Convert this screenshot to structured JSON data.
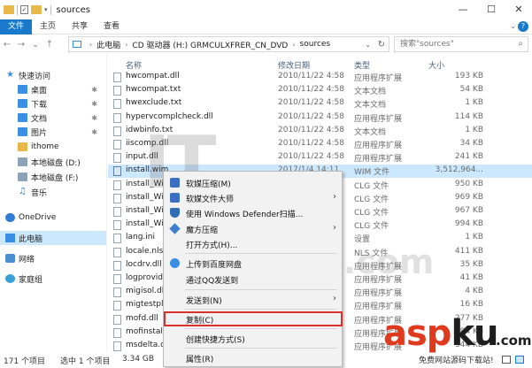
{
  "window": {
    "title": "sources",
    "minimize": "—",
    "maximize": "☐",
    "close": "✕"
  },
  "ribbon": {
    "tabs": [
      "文件",
      "主页",
      "共享",
      "查看"
    ],
    "help": "?"
  },
  "address": {
    "crumbs": [
      "此电脑",
      "CD 驱动器 (H:) GRMCULXFRER_CN_DVD",
      "sources"
    ],
    "search_placeholder": "搜索\"sources\""
  },
  "sidebar": {
    "items": [
      {
        "label": "快速访问",
        "icon": "star-icon"
      },
      {
        "label": "桌面",
        "icon": "desktop-folder-icon"
      },
      {
        "label": "下载",
        "icon": "download-folder-icon"
      },
      {
        "label": "文档",
        "icon": "documents-folder-icon"
      },
      {
        "label": "图片",
        "icon": "pictures-folder-icon"
      },
      {
        "label": "ithome",
        "icon": "folder-icon"
      },
      {
        "label": "本地磁盘 (D:)",
        "icon": "drive-icon"
      },
      {
        "label": "本地磁盘 (F:)",
        "icon": "drive-icon"
      },
      {
        "label": "音乐",
        "icon": "music-icon"
      },
      {
        "label": "OneDrive",
        "icon": "cloud-icon"
      },
      {
        "label": "此电脑",
        "icon": "computer-icon"
      },
      {
        "label": "网络",
        "icon": "network-icon"
      },
      {
        "label": "家庭组",
        "icon": "homegroup-icon"
      }
    ]
  },
  "columns": {
    "name": "名称",
    "date": "修改日期",
    "type": "类型",
    "size": "大小"
  },
  "files": [
    {
      "name": "hwcompat.dll",
      "date": "2010/11/22 4:58",
      "type": "应用程序扩展",
      "size": "193 KB"
    },
    {
      "name": "hwcompat.txt",
      "date": "2010/11/22 4:58",
      "type": "文本文档",
      "size": "54 KB"
    },
    {
      "name": "hwexclude.txt",
      "date": "2010/11/22 4:58",
      "type": "文本文档",
      "size": "1 KB"
    },
    {
      "name": "hypervcomplcheck.dll",
      "date": "2010/11/22 4:58",
      "type": "应用程序扩展",
      "size": "114 KB"
    },
    {
      "name": "idwbinfo.txt",
      "date": "2010/11/22 4:58",
      "type": "文本文档",
      "size": "1 KB"
    },
    {
      "name": "iiscomp.dll",
      "date": "2010/11/22 4:58",
      "type": "应用程序扩展",
      "size": "34 KB"
    },
    {
      "name": "input.dll",
      "date": "2010/11/22 4:58",
      "type": "应用程序扩展",
      "size": "241 KB"
    },
    {
      "name": "install.wim",
      "date": "2017/1/4 14:11",
      "type": "WIM 文件",
      "size": "3,512,964..."
    },
    {
      "name": "install_Wi",
      "date": "",
      "type": "CLG 文件",
      "size": "950 KB"
    },
    {
      "name": "install_Wi",
      "date": "",
      "type": "CLG 文件",
      "size": "969 KB"
    },
    {
      "name": "install_Wi",
      "date": "",
      "type": "CLG 文件",
      "size": "967 KB"
    },
    {
      "name": "install_Wi",
      "date": "",
      "type": "CLG 文件",
      "size": "994 KB"
    },
    {
      "name": "lang.ini",
      "date": "",
      "type": "设置",
      "size": "1 KB"
    },
    {
      "name": "locale.nls",
      "date": "",
      "type": "NLS 文件",
      "size": "411 KB"
    },
    {
      "name": "locdrv.dll",
      "date": "",
      "type": "应用程序扩展",
      "size": "35 KB"
    },
    {
      "name": "logprovide",
      "date": "",
      "type": "应用程序扩展",
      "size": "41 KB"
    },
    {
      "name": "migisol.dll",
      "date": "",
      "type": "应用程序扩展",
      "size": "4 KB"
    },
    {
      "name": "migtestplu",
      "date": "",
      "type": "应用程序扩展",
      "size": "16 KB"
    },
    {
      "name": "mofd.dll",
      "date": "",
      "type": "应用程序扩展",
      "size": "277 KB"
    },
    {
      "name": "mofinstall.",
      "date": "",
      "type": "应用程序扩展",
      "size": "84 KB"
    },
    {
      "name": "msdelta.dl",
      "date": "",
      "type": "应用程序扩展",
      "size": "344 KB"
    }
  ],
  "context_menu": {
    "items": [
      {
        "label": "软媒压缩(M)",
        "icon": "zip-icon",
        "submenu": false
      },
      {
        "label": "软媒文件大师",
        "icon": "zip-icon",
        "submenu": true
      },
      {
        "label": "使用 Windows Defender扫描...",
        "icon": "shield-icon",
        "submenu": false
      },
      {
        "label": "魔方压缩",
        "icon": "cube-icon",
        "submenu": true
      },
      {
        "label": "打开方式(H)...",
        "icon": "",
        "submenu": false
      },
      {
        "label": "上传到百度网盘",
        "icon": "upload-icon",
        "submenu": false
      },
      {
        "label": "通过QQ发送到",
        "icon": "",
        "submenu": false
      },
      {
        "label": "发送到(N)",
        "icon": "",
        "submenu": true
      },
      {
        "label": "复制(C)",
        "icon": "",
        "submenu": false
      },
      {
        "label": "创建快捷方式(S)",
        "icon": "",
        "submenu": false
      },
      {
        "label": "属性(R)",
        "icon": "",
        "submenu": false
      }
    ]
  },
  "status": {
    "count": "171 个项目",
    "selected": "选中 1 个项目",
    "size": "3.34 GB"
  },
  "watermark": {
    "brand": "IT",
    "url": "ithome.com"
  },
  "logo": {
    "asp": "asp",
    "ku": "ku",
    "com": ".com",
    "tagline": "免费网站源码下载站!"
  },
  "colors": {
    "accent": "#1979ca",
    "selection": "#cce8ff",
    "highlight_box": "#d9302c",
    "logo_red": "#e03a1e"
  }
}
